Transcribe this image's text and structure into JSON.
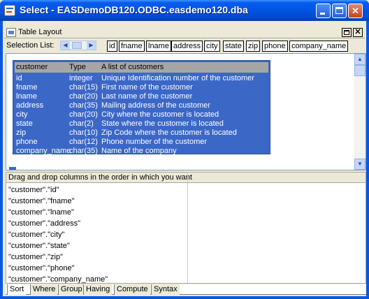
{
  "window": {
    "title": "Select - EASDemoDB120.ODBC.easdemo120.dba"
  },
  "panel": {
    "title": "Table Layout"
  },
  "selection_list": {
    "label": "Selection List:",
    "columns": [
      "id",
      "fname",
      "lname",
      "address",
      "city",
      "state",
      "zip",
      "phone",
      "company_name"
    ]
  },
  "table": {
    "headers": {
      "name": "customer",
      "type": "Type",
      "desc": "A list of customers"
    },
    "rows": [
      {
        "name": "id",
        "type": "integer",
        "desc": "Unique Identification number of the customer"
      },
      {
        "name": "fname",
        "type": "char(15)",
        "desc": "First name of the customer"
      },
      {
        "name": "lname",
        "type": "char(20)",
        "desc": "Last name of the customer"
      },
      {
        "name": "address",
        "type": "char(35)",
        "desc": "Mailing address of the customer"
      },
      {
        "name": "city",
        "type": "char(20)",
        "desc": "City where the customer is located"
      },
      {
        "name": "state",
        "type": "char(2)",
        "desc": "State where the customer is located"
      },
      {
        "name": "zip",
        "type": "char(10)",
        "desc": "Zip Code where the customer is located"
      },
      {
        "name": "phone",
        "type": "char(12)",
        "desc": "Phone number of the customer"
      },
      {
        "name": "company_name",
        "type": "char(35)",
        "desc": "Name of the company"
      }
    ]
  },
  "sort_pane": {
    "header": "Drag and drop columns in the order in which you want",
    "items": [
      "\"customer\".\"id\"",
      "\"customer\".\"fname\"",
      "\"customer\".\"lname\"",
      "\"customer\".\"address\"",
      "\"customer\".\"city\"",
      "\"customer\".\"state\"",
      "\"customer\".\"zip\"",
      "\"customer\".\"phone\"",
      "\"customer\".\"company_name\""
    ]
  },
  "tabs": [
    "Sort",
    "Where",
    "Group",
    "Having",
    "Compute",
    "Syntax"
  ],
  "active_tab": "Sort",
  "colors": {
    "title_bar": "#0054e3",
    "selection_blue": "#3b67c7",
    "header_gray": "#a6a6a6"
  }
}
